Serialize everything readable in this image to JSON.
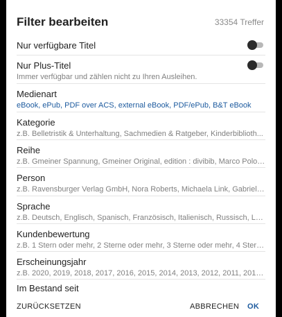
{
  "dialog": {
    "title": "Filter bearbeiten",
    "result_count": "33354 Treffer"
  },
  "toggles": [
    {
      "label": "Nur verfügbare Titel",
      "checked": false
    },
    {
      "label": "Nur Plus-Titel",
      "sub": "Immer verfügbar und zählen nicht zu Ihren Ausleihen.",
      "checked": false
    }
  ],
  "filters": [
    {
      "label": "Medienart",
      "sub": "eBook, ePub, PDF over ACS, external eBook, PDF/ePub, B&T eBook"
    },
    {
      "label": "Kategorie",
      "sub": "z.B. Belletristik & Unterhaltung, Sachmedien & Ratgeber, Kinderbiblioth..."
    },
    {
      "label": "Reihe",
      "sub": "z.B. Gmeiner Spannung, Gmeiner Original, edition : divibib, Marco Polo, ..."
    },
    {
      "label": "Person",
      "sub": "z.B. Ravensburger Verlag GmbH, Nora Roberts, Michaela Link, Gabriele ..."
    },
    {
      "label": "Sprache",
      "sub": "z.B. Deutsch, Englisch, Spanisch, Französisch, Italienisch, Russisch, La..."
    },
    {
      "label": "Kundenbewertung",
      "sub": "z.B. 1 Stern oder mehr, 2 Sterne oder mehr, 3 Sterne oder mehr, 4 Stern..."
    },
    {
      "label": "Erscheinungsjahr",
      "sub": "z.B. 2020, 2019, 2018, 2017, 2016, 2015, 2014, 2013, 2012, 2011, 2010,..."
    },
    {
      "label": "Im Bestand seit"
    }
  ],
  "footer": {
    "reset_label": "ZURÜCKSETZEN",
    "cancel_label": "ABBRECHEN",
    "ok_label": "OK"
  },
  "colors": {
    "accent": "#1c5a9e",
    "toggle_knob": "#2b2b2b",
    "toggle_track": "#b8b8b8"
  }
}
